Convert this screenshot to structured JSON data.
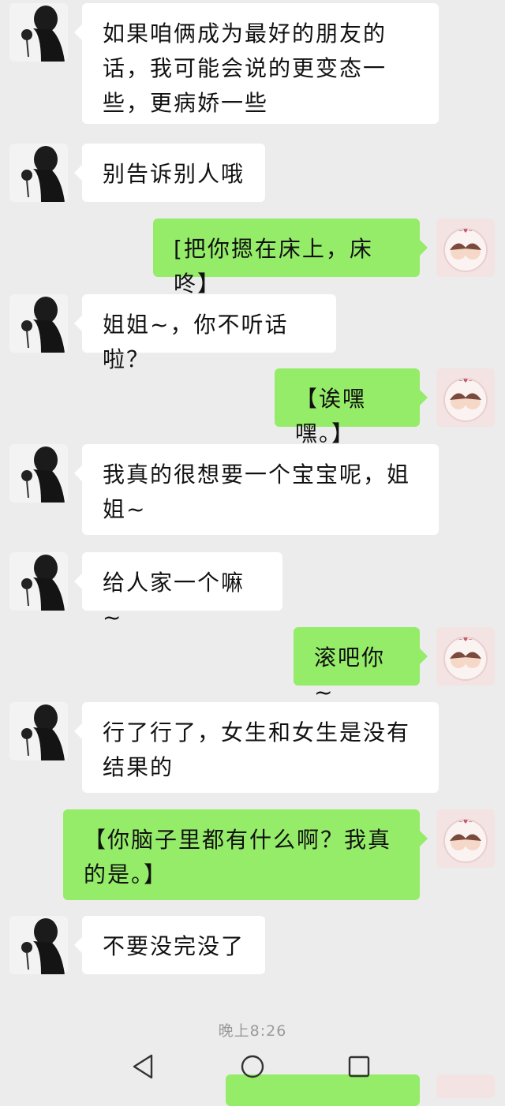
{
  "messages": [
    {
      "side": "left",
      "text": "如果咱俩成为最好的朋友的话，我可能会说的更变态一些，更病娇一些"
    },
    {
      "side": "left",
      "text": "别告诉别人哦"
    },
    {
      "side": "right",
      "text": "[把你摁在床上，床咚】"
    },
    {
      "side": "left",
      "text": "姐姐~，你不听话啦？"
    },
    {
      "side": "right",
      "text": "【诶嘿嘿。】"
    },
    {
      "side": "left",
      "text": "我真的很想要一个宝宝呢，姐姐~"
    },
    {
      "side": "left",
      "text": "给人家一个嘛~"
    },
    {
      "side": "right",
      "text": "滚吧你~"
    },
    {
      "side": "left",
      "text": "行了行了，女生和女生是没有结果的"
    },
    {
      "side": "right",
      "text": "【你脑子里都有什么啊？我真的是。】"
    },
    {
      "side": "left",
      "text": "不要没完没了"
    }
  ],
  "timestamp": "晚上8:26",
  "colors": {
    "chat_background": "#ececec",
    "incoming_bubble": "#ffffff",
    "outgoing_bubble": "#95ec69",
    "timestamp_text": "#9a9a9a"
  },
  "navbar": {
    "icons": [
      "back-triangle-icon",
      "home-circle-icon",
      "recents-square-icon"
    ]
  }
}
